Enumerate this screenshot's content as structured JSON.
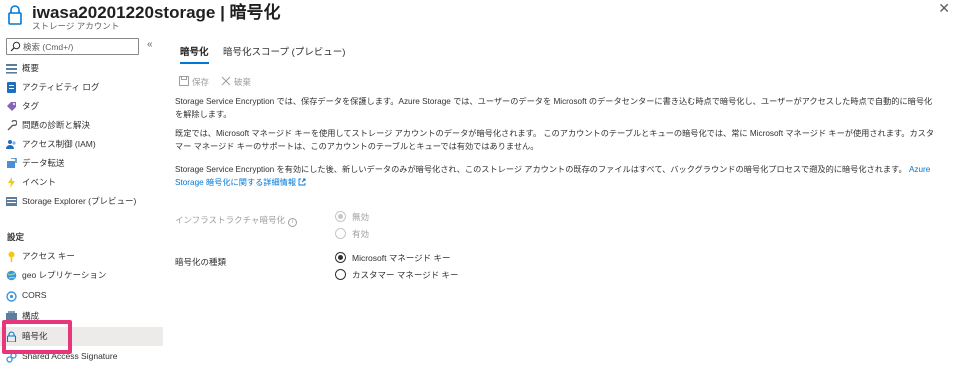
{
  "header": {
    "title": "iwasa20201220storage | 暗号化",
    "subtitle": "ストレージ アカウント",
    "close_glyph": "✕"
  },
  "sidebar": {
    "search_placeholder": "検索 (Cmd+/)",
    "collapse_glyph": "«",
    "items": [
      {
        "label": "概要",
        "icon": "overview-icon"
      },
      {
        "label": "アクティビティ ログ",
        "icon": "activity-log-icon"
      },
      {
        "label": "タグ",
        "icon": "tag-icon"
      },
      {
        "label": "問題の診断と解決",
        "icon": "wrench-icon"
      },
      {
        "label": "アクセス制御 (IAM)",
        "icon": "people-icon"
      },
      {
        "label": "データ転送",
        "icon": "data-transfer-icon"
      },
      {
        "label": "イベント",
        "icon": "lightning-icon"
      },
      {
        "label": "Storage Explorer (プレビュー)",
        "icon": "storage-explorer-icon"
      }
    ],
    "section_settings": "設定",
    "settings_items": [
      {
        "label": "アクセス キー",
        "icon": "key-icon"
      },
      {
        "label": "geo レプリケーション",
        "icon": "globe-icon"
      },
      {
        "label": "CORS",
        "icon": "cors-icon"
      },
      {
        "label": "構成",
        "icon": "configuration-icon"
      },
      {
        "label": "暗号化",
        "icon": "lock-icon"
      },
      {
        "label": "Shared Access Signature",
        "icon": "link-icon"
      }
    ]
  },
  "main": {
    "tabs": [
      {
        "label": "暗号化"
      },
      {
        "label": "暗号化スコープ (プレビュー)"
      }
    ],
    "toolbar": {
      "save_label": "保存",
      "discard_label": "破棄"
    },
    "paragraphs": {
      "p1": "Storage Service Encryption では、保存データを保護します。Azure Storage では、ユーザーのデータを Microsoft のデータセンターに書き込む時点で暗号化し、ユーザーがアクセスした時点で自動的に暗号化を解除します。",
      "p2": "既定では、Microsoft マネージド キーを使用してストレージ アカウントのデータが暗号化されます。 このアカウントのテーブルとキューの暗号化では、常に Microsoft マネージド キーが使用されます。カスタマー マネージド キーのサポートは、このアカウントのテーブルとキューでは有効ではありません。",
      "p3": "Storage Service Encryption を有効にした後、新しいデータのみが暗号化され、このストレージ アカウントの既存のファイルはすべて、バックグラウンドの暗号化プロセスで遡及的に暗号化されます。",
      "p3_link": "Azure Storage 暗号化に関する詳細情報"
    },
    "infra_encryption": {
      "label": "インフラストラクチャ暗号化",
      "options": [
        "無効",
        "有効"
      ],
      "selected": "無効"
    },
    "encryption_type": {
      "label": "暗号化の種類",
      "options": [
        "Microsoft マネージド キー",
        "カスタマー マネージド キー"
      ],
      "selected": "Microsoft マネージド キー"
    }
  },
  "colors": {
    "accent": "#0078d4",
    "highlight": "#e8367a",
    "active_bg": "#edebe9"
  }
}
